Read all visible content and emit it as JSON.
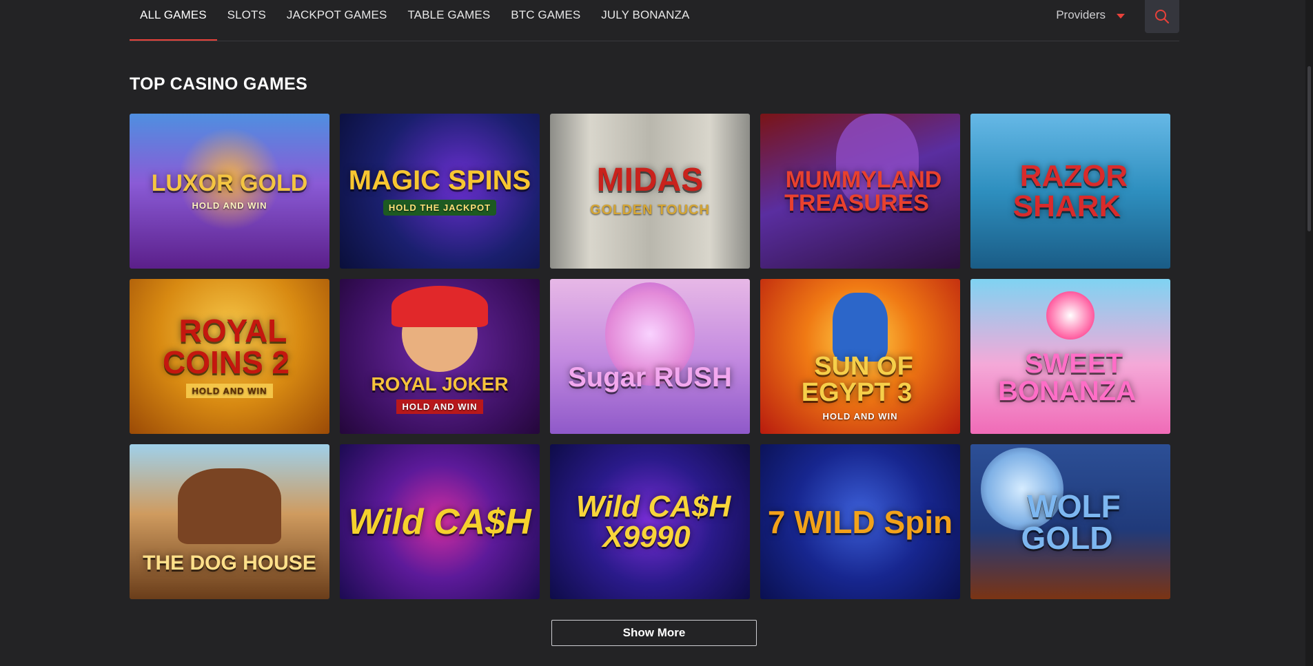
{
  "nav": {
    "tabs": [
      "ALL GAMES",
      "SLOTS",
      "JACKPOT GAMES",
      "TABLE GAMES",
      "BTC GAMES",
      "JULY BONANZA"
    ],
    "active_tab": 0,
    "providers_label": "Providers",
    "accent_color": "#e8413a"
  },
  "section": {
    "title": "TOP CASINO GAMES"
  },
  "games": [
    {
      "title": "LUXOR GOLD",
      "subtitle": "HOLD AND WIN"
    },
    {
      "title": "MAGIC SPINS",
      "subtitle": "HOLD THE JACKPOT"
    },
    {
      "title": "MIDAS",
      "subtitle": "GOLDEN TOUCH"
    },
    {
      "title": "MUMMYLAND TREASURES",
      "subtitle": ""
    },
    {
      "title": "RAZOR SHARK",
      "subtitle": ""
    },
    {
      "title": "ROYAL COINS 2",
      "subtitle": "HOLD AND WIN"
    },
    {
      "title": "ROYAL JOKER",
      "subtitle": "HOLD AND WIN"
    },
    {
      "title": "Sugar RUSH",
      "subtitle": ""
    },
    {
      "title": "SUN OF EGYPT 3",
      "subtitle": "HOLD AND WIN"
    },
    {
      "title": "SWEET BONANZA",
      "subtitle": ""
    },
    {
      "title": "THE DOG HOUSE",
      "subtitle": ""
    },
    {
      "title": "Wild CA$H",
      "subtitle": ""
    },
    {
      "title": "Wild CA$H X9990",
      "subtitle": ""
    },
    {
      "title": "7 WILD Spin",
      "subtitle": ""
    },
    {
      "title": "WOLF GOLD",
      "subtitle": ""
    }
  ],
  "show_more_label": "Show More"
}
